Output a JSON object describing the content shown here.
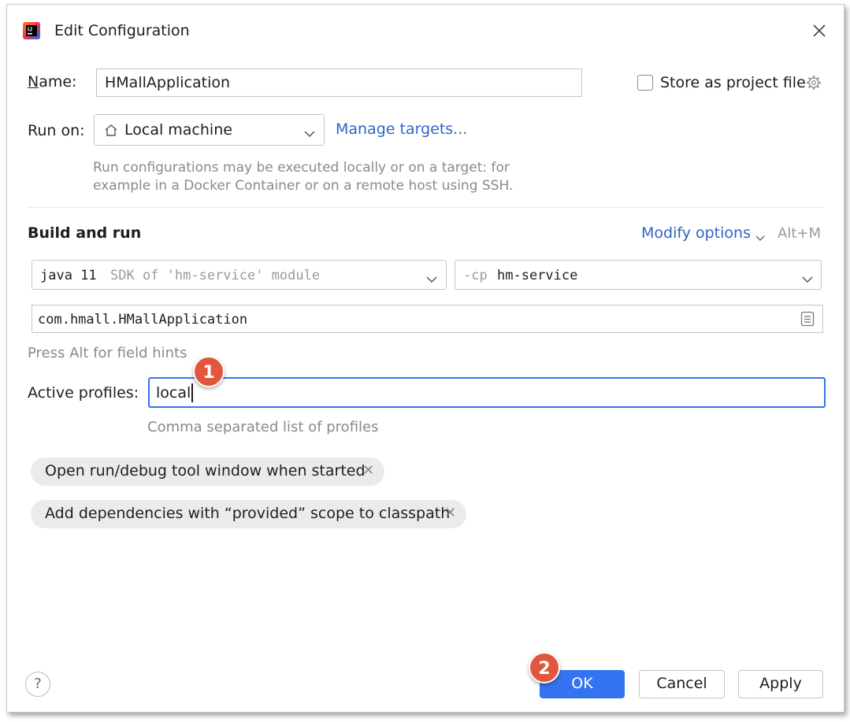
{
  "dialog": {
    "title": "Edit Configuration",
    "app_icon": "intellij-idea-icon",
    "close_icon": "close-icon"
  },
  "name": {
    "label_first": "N",
    "label_rest": "ame:",
    "value": "HMallApplication"
  },
  "store_project_file": {
    "label": "Store as project file",
    "checked": false,
    "icon": "gear-icon"
  },
  "run_on": {
    "label": "Run on:",
    "value": "Local machine",
    "icon": "home-icon",
    "manage_link": "Manage targets...",
    "hint_line1": "Run configurations may be executed locally or on a target: for",
    "hint_line2": "example in a Docker Container or on a remote host using SSH."
  },
  "build_run": {
    "heading": "Build and run",
    "modify_options": "Modify options",
    "shortcut": "Alt+M",
    "sdk_java": "java 11",
    "sdk_desc": "SDK of 'hm-service' module",
    "cp_flag": "-cp",
    "cp_module": "hm-service",
    "main_class": "com.hmall.HMallApplication",
    "field_hints": "Press Alt for field hints"
  },
  "active_profiles": {
    "label": "Active profiles:",
    "value": "local",
    "hint": "Comma separated list of profiles"
  },
  "options": [
    {
      "label": "Open run/debug tool window when started"
    },
    {
      "label": "Add dependencies with “provided” scope to classpath"
    }
  ],
  "buttons": {
    "help": "?",
    "ok": "OK",
    "cancel": "Cancel",
    "apply": "Apply"
  },
  "annotations": {
    "step1": "1",
    "step2": "2"
  },
  "colors": {
    "accent": "#3574f0",
    "link": "#2f63c8",
    "badge": "#e1573d"
  }
}
